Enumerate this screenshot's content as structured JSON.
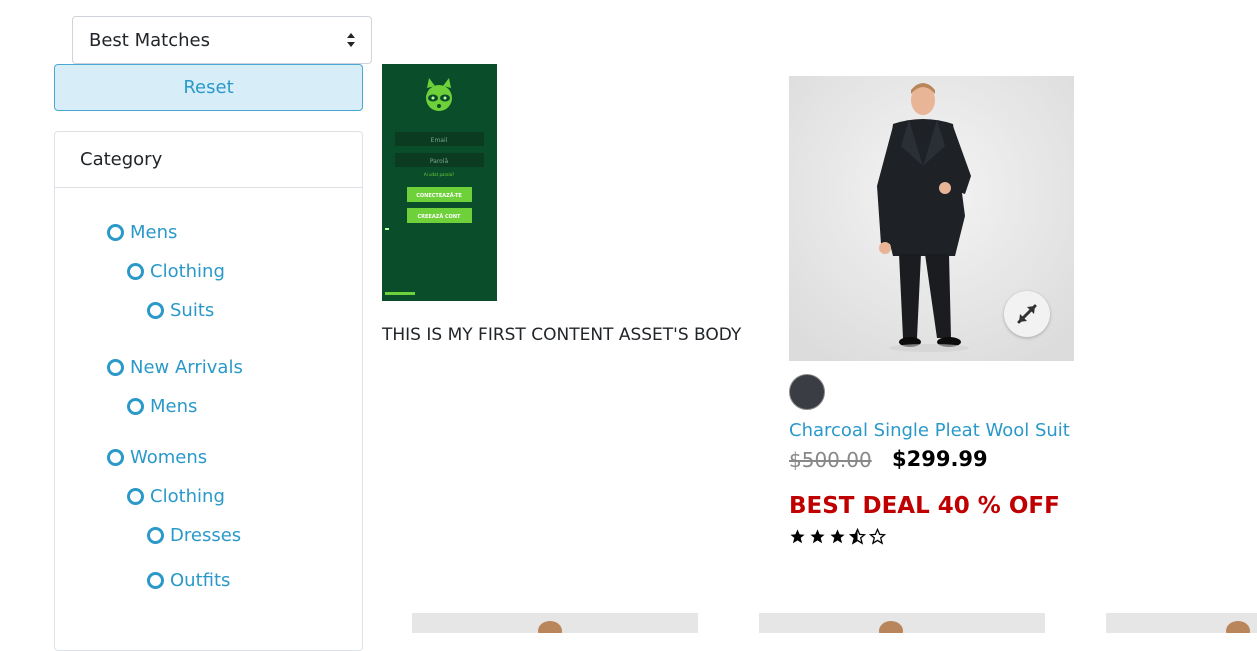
{
  "sort": {
    "selected": "Best Matches"
  },
  "reset_label": "Reset",
  "refinement": {
    "title": "Category",
    "items": [
      {
        "label": "Mens"
      },
      {
        "label": "Clothing"
      },
      {
        "label": "Suits"
      },
      {
        "label": "New Arrivals"
      },
      {
        "label": "Mens"
      },
      {
        "label": "Womens"
      },
      {
        "label": "Clothing"
      },
      {
        "label": "Dresses"
      },
      {
        "label": "Outfits"
      }
    ]
  },
  "content_asset": {
    "body": "THIS IS MY FIRST CONTENT ASSET'S BODY",
    "mock_fields": [
      "Email",
      "Parolă"
    ],
    "mock_link": "Ai uitat parola?",
    "mock_buttons": [
      "CONECTEAZĂ-TE",
      "CREEAZĂ CONT"
    ]
  },
  "product": {
    "name": "Charcoal Single Pleat Wool Suit",
    "price_old": "$500.00",
    "price_new": "$299.99",
    "promo": "BEST DEAL 40 % OFF",
    "rating": 3.5,
    "rating_max": 5,
    "swatch_color": "#3a3d44"
  },
  "colors": {
    "link": "#2a99c9",
    "promo": "#c00000",
    "asset_bg": "#0a4d2a"
  }
}
